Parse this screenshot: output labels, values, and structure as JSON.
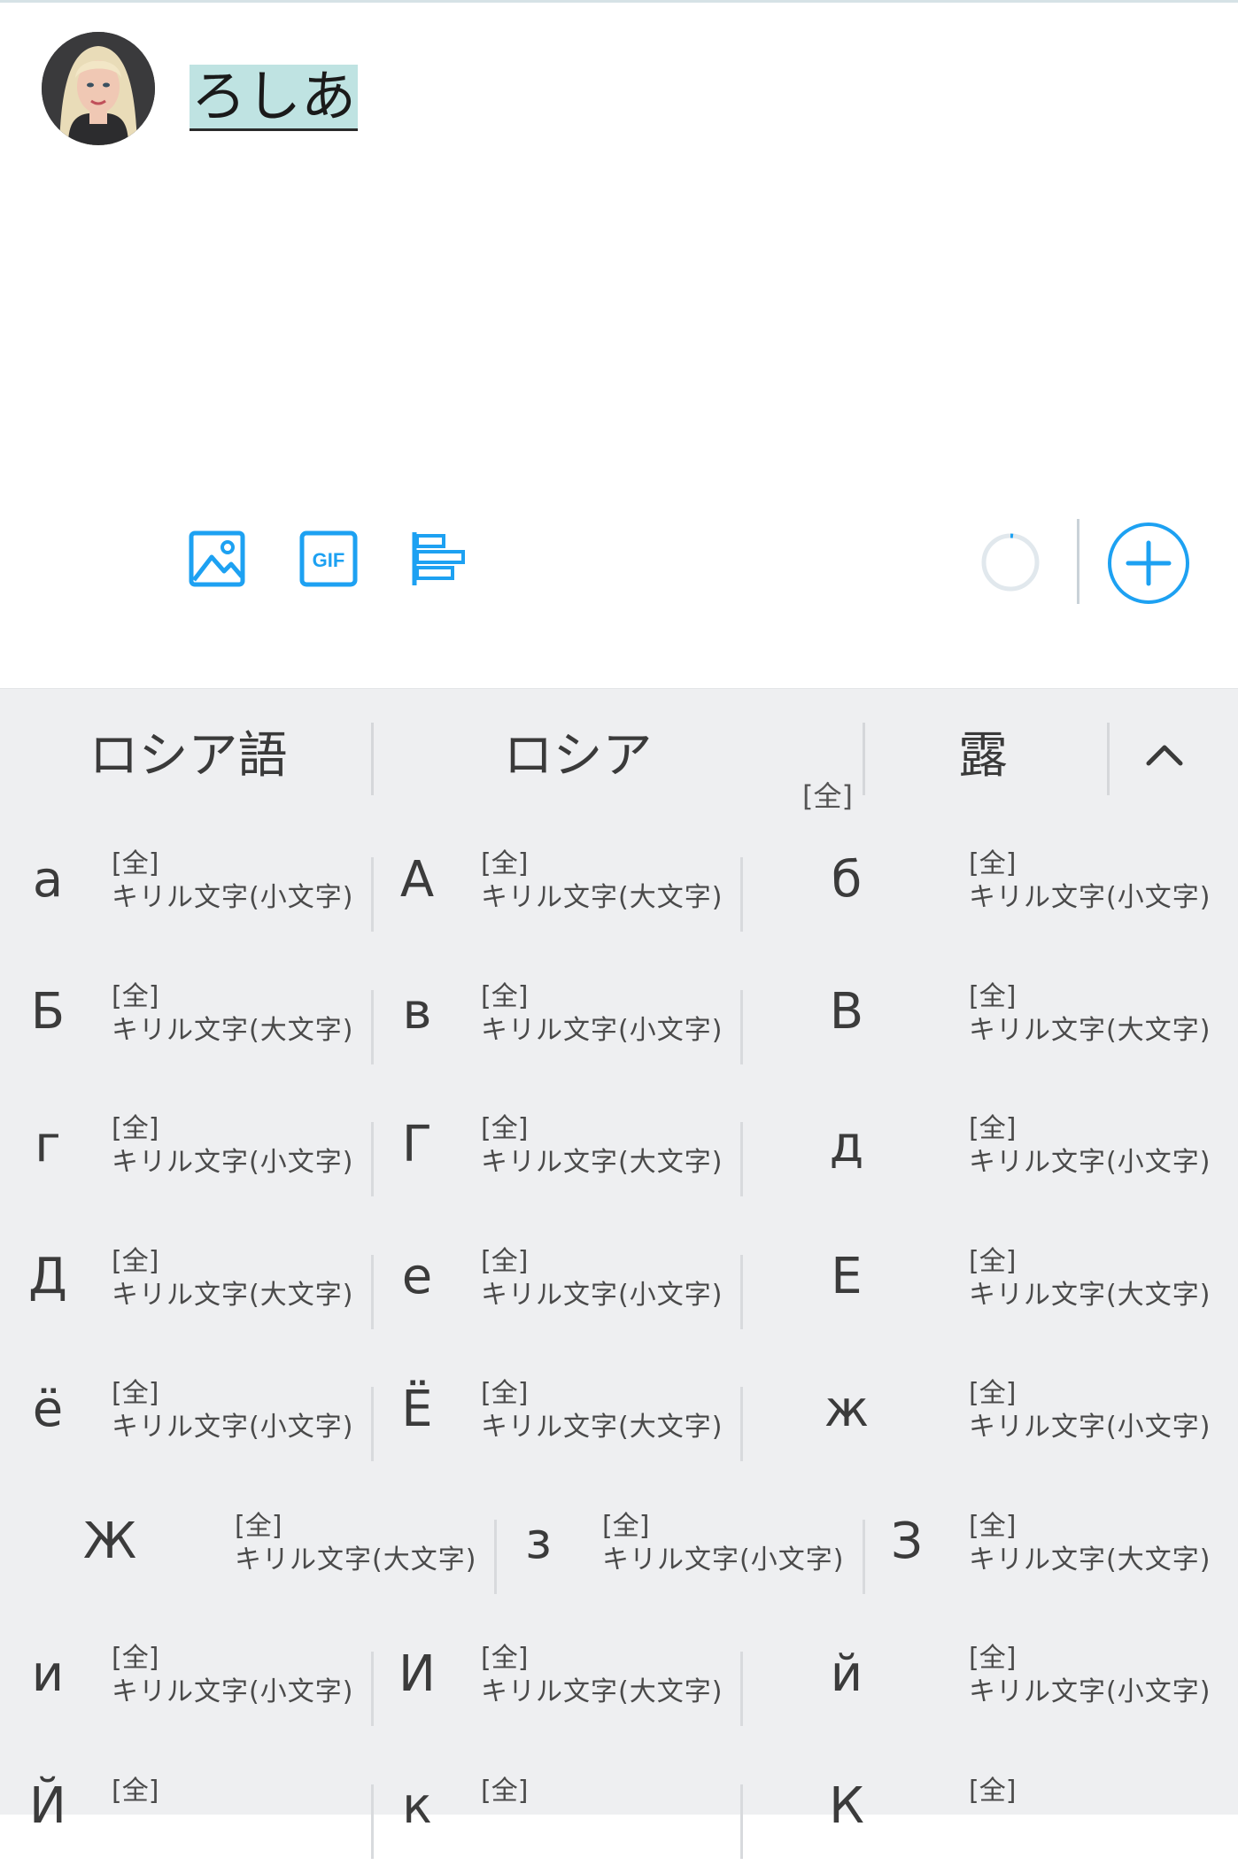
{
  "compose": {
    "text": "ろしあ"
  },
  "toolbar": {
    "icons": [
      "image-icon",
      "gif-icon",
      "poll-icon"
    ],
    "gif_label": "GIF",
    "accent_color": "#1da1f2"
  },
  "candidates": {
    "items": [
      "ロシア語",
      "ロシア",
      "露"
    ],
    "tag": "[全]",
    "expand_icon": "chevron-up-icon"
  },
  "grid": {
    "rows": [
      [
        {
          "char": "а",
          "tag": "[全]",
          "desc": "キリル文字(小文字)"
        },
        {
          "char": "А",
          "tag": "[全]",
          "desc": "キリル文字(大文字)"
        },
        {
          "char": "б",
          "tag": "[全]",
          "desc": "キリル文字(小文字)"
        }
      ],
      [
        {
          "char": "Б",
          "tag": "[全]",
          "desc": "キリル文字(大文字)"
        },
        {
          "char": "в",
          "tag": "[全]",
          "desc": "キリル文字(小文字)"
        },
        {
          "char": "В",
          "tag": "[全]",
          "desc": "キリル文字(大文字)"
        }
      ],
      [
        {
          "char": "г",
          "tag": "[全]",
          "desc": "キリル文字(小文字)"
        },
        {
          "char": "Г",
          "tag": "[全]",
          "desc": "キリル文字(大文字)"
        },
        {
          "char": "д",
          "tag": "[全]",
          "desc": "キリル文字(小文字)"
        }
      ],
      [
        {
          "char": "Д",
          "tag": "[全]",
          "desc": "キリル文字(大文字)"
        },
        {
          "char": "е",
          "tag": "[全]",
          "desc": "キリル文字(小文字)"
        },
        {
          "char": "Е",
          "tag": "[全]",
          "desc": "キリル文字(大文字)"
        }
      ],
      [
        {
          "char": "ё",
          "tag": "[全]",
          "desc": "キリル文字(小文字)"
        },
        {
          "char": "Ё",
          "tag": "[全]",
          "desc": "キリル文字(大文字)"
        },
        {
          "char": "ж",
          "tag": "[全]",
          "desc": "キリル文字(小文字)"
        }
      ],
      [
        {
          "char": "Ж",
          "tag": "[全]",
          "desc": "キリル文字(大文字)"
        },
        {
          "char": "з",
          "tag": "[全]",
          "desc": "キリル文字(小文字)"
        },
        {
          "char": "З",
          "tag": "[全]",
          "desc": "キリル文字(大文字)"
        }
      ],
      [
        {
          "char": "и",
          "tag": "[全]",
          "desc": "キリル文字(小文字)"
        },
        {
          "char": "И",
          "tag": "[全]",
          "desc": "キリル文字(大文字)"
        },
        {
          "char": "й",
          "tag": "[全]",
          "desc": "キリル文字(小文字)"
        }
      ],
      [
        {
          "char": "Й",
          "tag": "[全]",
          "desc": ""
        },
        {
          "char": "к",
          "tag": "[全]",
          "desc": ""
        },
        {
          "char": "К",
          "tag": "[全]",
          "desc": ""
        }
      ]
    ]
  }
}
